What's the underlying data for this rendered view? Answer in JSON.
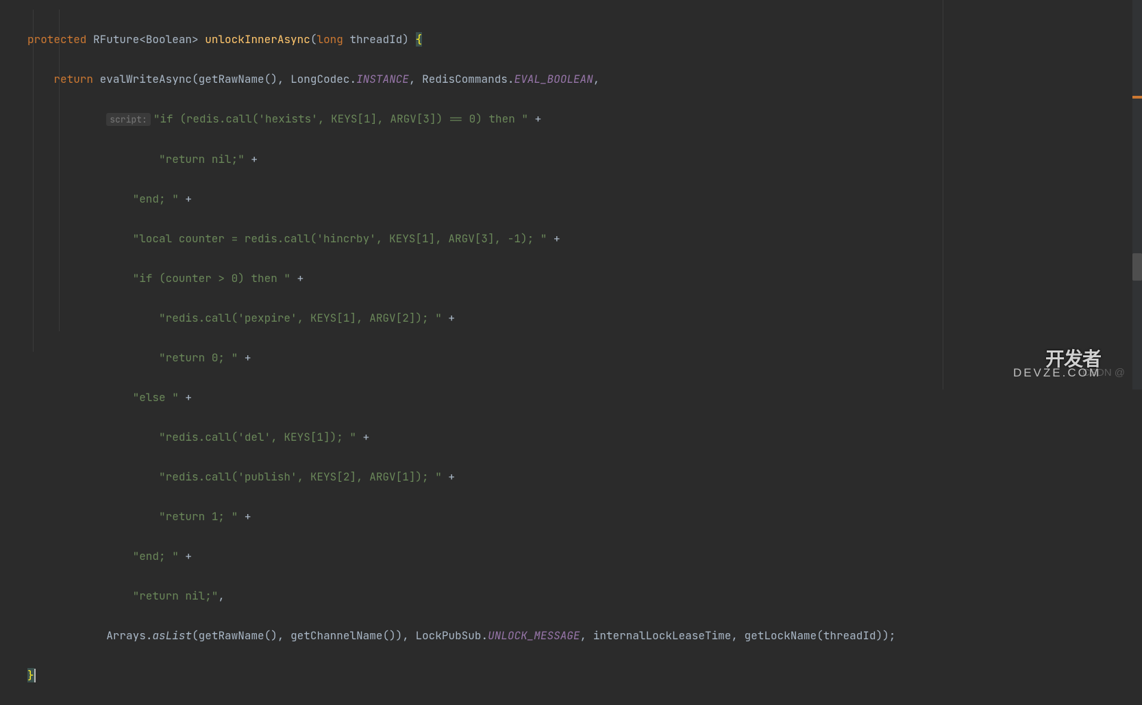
{
  "code": {
    "l1": {
      "kw_protected": "protected",
      "type_rfuture": "RFuture",
      "generic_open": "<",
      "generic_type": "Boolean",
      "generic_close": ">",
      "method_name": "unlockInnerAsync",
      "paren_open": "(",
      "kw_long": "long",
      "param_name": "threadId",
      "paren_close": ")",
      "brace_open": "{"
    },
    "l2": {
      "kw_return": "return",
      "method_eval": "evalWriteAsync",
      "paren_open": "(",
      "method_getraw": "getRawName",
      "parens_empty": "()",
      "comma1": ", ",
      "class_longcodec": "LongCodec",
      "dot1": ".",
      "field_instance": "INSTANCE",
      "comma2": ", ",
      "class_rediscmd": "RedisCommands",
      "dot2": ".",
      "field_evalbool": "EVAL_BOOLEAN",
      "comma3": ","
    },
    "l3": {
      "hint": "script:",
      "str": "\"if (redis.call('hexists', KEYS[1], ARGV[3]) == 0) then \"",
      "plus": " +"
    },
    "l4": {
      "str": "\"return nil;\"",
      "plus": " +"
    },
    "l5": {
      "str": "\"end; \"",
      "plus": " +"
    },
    "l6": {
      "str": "\"local counter = redis.call('hincrby', KEYS[1], ARGV[3], -1); \"",
      "plus": " +"
    },
    "l7": {
      "str": "\"if (counter > 0) then \"",
      "plus": " +"
    },
    "l8": {
      "str": "\"redis.call('pexpire', KEYS[1], ARGV[2]); \"",
      "plus": " +"
    },
    "l9": {
      "str": "\"return 0; \"",
      "plus": " +"
    },
    "l10": {
      "str": "\"else \"",
      "plus": " +"
    },
    "l11": {
      "str": "\"redis.call('del', KEYS[1]); \"",
      "plus": " +"
    },
    "l12": {
      "str": "\"redis.call('publish', KEYS[2], ARGV[1]); \"",
      "plus": " +"
    },
    "l13": {
      "str": "\"return 1; \"",
      "plus": " +"
    },
    "l14": {
      "str": "\"end; \"",
      "plus": " +"
    },
    "l15": {
      "str": "\"return nil;\"",
      "comma": ","
    },
    "l16": {
      "class_arrays": "Arrays",
      "dot1": ".",
      "method_aslist": "asList",
      "paren_open": "(",
      "method_getraw": "getRawName",
      "parens1": "()",
      "comma1": ", ",
      "method_getchan": "getChannelName",
      "parens2": "())",
      "comma2": ", ",
      "class_lockpubsub": "LockPubSub",
      "dot2": ".",
      "field_unlockmsg": "UNLOCK_MESSAGE",
      "comma3": ", ",
      "field_leasetime": "internalLockLeaseTime",
      "comma4": ", ",
      "method_getlockname": "getLockName",
      "paren_open2": "(",
      "param_threadid": "threadId",
      "paren_close": "));"
    },
    "l17": {
      "brace_close": "}"
    }
  },
  "watermark": "CSDN @",
  "logo": "开发者",
  "logo_sub": "DEVZE.COM"
}
